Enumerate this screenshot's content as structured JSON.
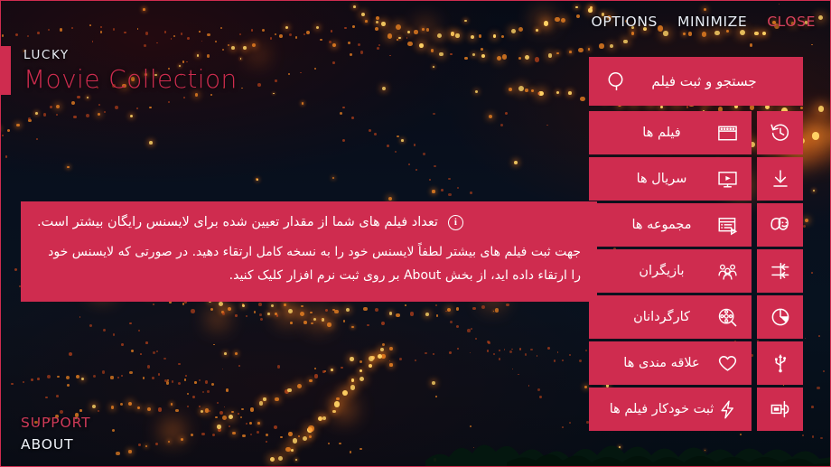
{
  "app": {
    "brand_small": "LUCKY",
    "brand_big": "Movie Collection"
  },
  "colors": {
    "accent": "#CF2C4F",
    "accent_text": "#D8415F",
    "panel": "#CF2C4F",
    "background_dark": "#060A14",
    "text_light": "#E9EEF6"
  },
  "topnav": {
    "items": [
      {
        "label": "OPTIONS",
        "name": "options",
        "style": "light"
      },
      {
        "label": "MINIMIZE",
        "name": "minimize",
        "style": "light"
      },
      {
        "label": "CLOSE",
        "name": "close",
        "style": "danger"
      }
    ]
  },
  "footer": {
    "support_label": "SUPPORT",
    "about_label": "ABOUT"
  },
  "banner": {
    "icon": "info-circle-icon",
    "icon_glyph": "i",
    "line1": "تعداد فیلم های شما از مقدار تعیین شده برای لایسنس رایگان بیشتر است.",
    "line2": "جهت ثبت فیلم های بیشتر لطفاً لایسنس خود را به نسخه کامل ارتقاء دهید. در صورتی که لایسنس خود را ارتقاء داده اید، از بخش About بر روی ثبت نرم افزار کلیک کنید."
  },
  "search": {
    "label": "جستجو و ثبت فیلم",
    "icon": "search-icon"
  },
  "menu": {
    "rows": [
      {
        "label": "فیلم ها",
        "name": "movies",
        "main_icon": "film-strip-icon",
        "side_icon": "history-clock-icon",
        "side_name": "history"
      },
      {
        "label": "سریال ها",
        "name": "series",
        "main_icon": "tv-play-icon",
        "side_icon": "download-icon",
        "side_name": "download"
      },
      {
        "label": "مجموعه ها",
        "name": "collections",
        "main_icon": "list-play-icon",
        "side_icon": "theater-masks-icon",
        "side_name": "genres"
      },
      {
        "label": "بازیگران",
        "name": "actors",
        "main_icon": "people-group-icon",
        "side_icon": "import-arrows-icon",
        "side_name": "import"
      },
      {
        "label": "کارگردانان",
        "name": "directors",
        "main_icon": "film-reel-search-icon",
        "side_icon": "pie-chart-icon",
        "side_name": "statistics"
      },
      {
        "label": "علاقه مندی ها",
        "name": "favorites",
        "main_icon": "heart-icon",
        "side_icon": "usb-icon",
        "side_name": "portable"
      },
      {
        "label": "ثبت خودکار فیلم ها",
        "name": "auto-register",
        "main_icon": "lightning-bolt-icon",
        "side_icon": "projector-icon",
        "side_name": "projector"
      }
    ]
  }
}
